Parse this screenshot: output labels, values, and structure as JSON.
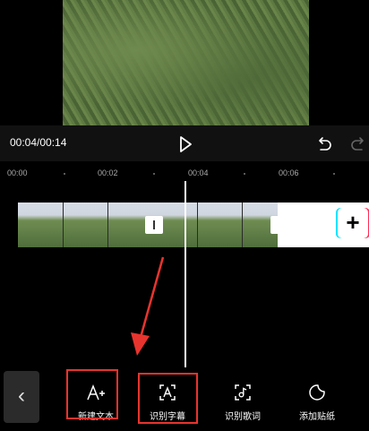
{
  "player": {
    "timecode": "00:04/00:14",
    "play_icon": "play-icon",
    "undo_icon": "undo-icon",
    "redo_icon": "redo-icon"
  },
  "ruler": {
    "labels": [
      "00:00",
      "00:02",
      "00:04",
      "00:06"
    ]
  },
  "track": {
    "add_clip_label": "+"
  },
  "toolbar": {
    "back_icon": "chevron-left-icon",
    "back_label": "‹",
    "tools": [
      {
        "label": "新建文本",
        "icon": "add-text-icon"
      },
      {
        "label": "识别字幕",
        "icon": "recognize-subtitle-icon"
      },
      {
        "label": "识别歌词",
        "icon": "recognize-lyrics-icon"
      },
      {
        "label": "添加贴纸",
        "icon": "sticker-icon"
      }
    ]
  },
  "colors": {
    "highlight": "#e8342e",
    "accent_cyan": "#00e5ff",
    "accent_pink": "#ff2d55"
  }
}
